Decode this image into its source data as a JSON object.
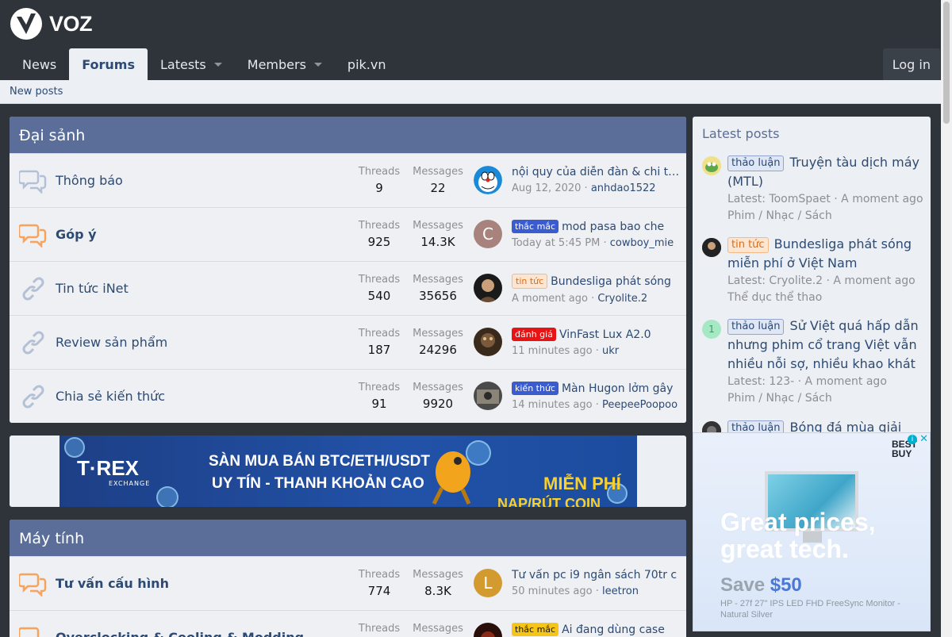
{
  "site": {
    "name": "VOZ"
  },
  "nav": {
    "news": "News",
    "forums": "Forums",
    "latests": "Latests",
    "members": "Members",
    "pik": "pik.vn",
    "login": "Log in"
  },
  "subnav": {
    "new_posts": "New posts"
  },
  "labels": {
    "threads": "Threads",
    "messages": "Messages"
  },
  "categories": [
    {
      "title": "Đại sảnh",
      "nodes": [
        {
          "title": "Thông báo",
          "threads": "9",
          "messages": "22",
          "prefix": "",
          "last_title": "nội quy của diễn đàn & chi tiết",
          "last_date": "Aug 12, 2020",
          "last_user": "anhdao1522",
          "avatar_letter": "",
          "bold": false
        },
        {
          "title": "Góp ý",
          "threads": "925",
          "messages": "14.3K",
          "prefix": "thắc mắc",
          "last_title": "mod pasa bao che",
          "last_date": "Today at 5:45 PM",
          "last_user": "cowboy_mie",
          "avatar_letter": "C",
          "bold": true
        },
        {
          "title": "Tin tức iNet",
          "threads": "540",
          "messages": "35656",
          "prefix": "tin tức",
          "last_title": "Bundesliga phát sóng",
          "last_date": "A moment ago",
          "last_user": "Cryolite.2",
          "avatar_letter": "",
          "bold": false
        },
        {
          "title": "Review sản phẩm",
          "threads": "187",
          "messages": "24296",
          "prefix": "đánh giá",
          "last_title": "VinFast Lux A2.0",
          "last_date": "11 minutes ago",
          "last_user": "ukr",
          "avatar_letter": "",
          "bold": false
        },
        {
          "title": "Chia sẻ kiến thức",
          "threads": "91",
          "messages": "9920",
          "prefix": "kiến thức",
          "last_title": "Màn Hugon lởm gây",
          "last_date": "14 minutes ago",
          "last_user": "PeepeePoopoo",
          "avatar_letter": "",
          "bold": false
        }
      ]
    },
    {
      "title": "Máy tính",
      "nodes": [
        {
          "title": "Tư vấn cấu hình",
          "threads": "774",
          "messages": "8.3K",
          "prefix": "",
          "last_title": "Tư vấn pc i9 ngân sách 70tr c",
          "last_date": "50 minutes ago",
          "last_user": "leetron",
          "avatar_letter": "L",
          "bold": true
        },
        {
          "title": "Overclocking & Cooling & Modding",
          "threads": "",
          "messages": "",
          "prefix": "thắc mắc",
          "last_title": "Ai đang dùng case",
          "last_date": "",
          "last_user": "",
          "avatar_letter": "",
          "bold": true
        }
      ]
    }
  ],
  "banner": {
    "logo": "T·REX",
    "logo_sub": "EXCHANGE",
    "line1": "SÀN MUA BÁN BTC/ETH/USDT",
    "line2": "UY TÍN - THANH KHOẢN CAO",
    "line3": "MIỄN PHÍ",
    "line4": "NẠP/RÚT COIN"
  },
  "sidebar": {
    "title": "Latest posts",
    "items": [
      {
        "prefix": "thảo luận",
        "title": "Truyện tàu dịch máy (MTL)",
        "latest": "Latest: ToomSpaet · A moment ago",
        "forum": "Phim / Nhạc / Sách",
        "avatar": ""
      },
      {
        "prefix": "tin tức",
        "title": "Bundesliga phát sóng miễn phí ở Việt Nam",
        "latest": "Latest: Cryolite.2 · A moment ago",
        "forum": "Thể dục thể thao",
        "avatar": ""
      },
      {
        "prefix": "thảo luận",
        "title": "Sử Việt quá hấp dẫn nhưng phim cổ trang Việt vẫn nhiều nỗi sợ, nhiều khao khát",
        "latest": "Latest: 123- · A moment ago",
        "forum": "Phim / Nhạc / Sách",
        "avatar": "1"
      },
      {
        "prefix": "thảo luận",
        "title": "Bóng đá mùa giải",
        "latest": "",
        "forum": "",
        "avatar": ""
      }
    ]
  },
  "ad": {
    "headline1": "Great prices,",
    "headline2": "great tech.",
    "save_label": "Save ",
    "save_amount": "$50",
    "description": "HP - 27f 27\" IPS LED FHD FreeSync Monitor - Natural Silver",
    "brand": "BEST BUY"
  },
  "colors": {
    "header_bg": "#2f343b",
    "category_head": "#5a6e99",
    "link": "#2d4a73",
    "muted": "#8c8f93"
  }
}
